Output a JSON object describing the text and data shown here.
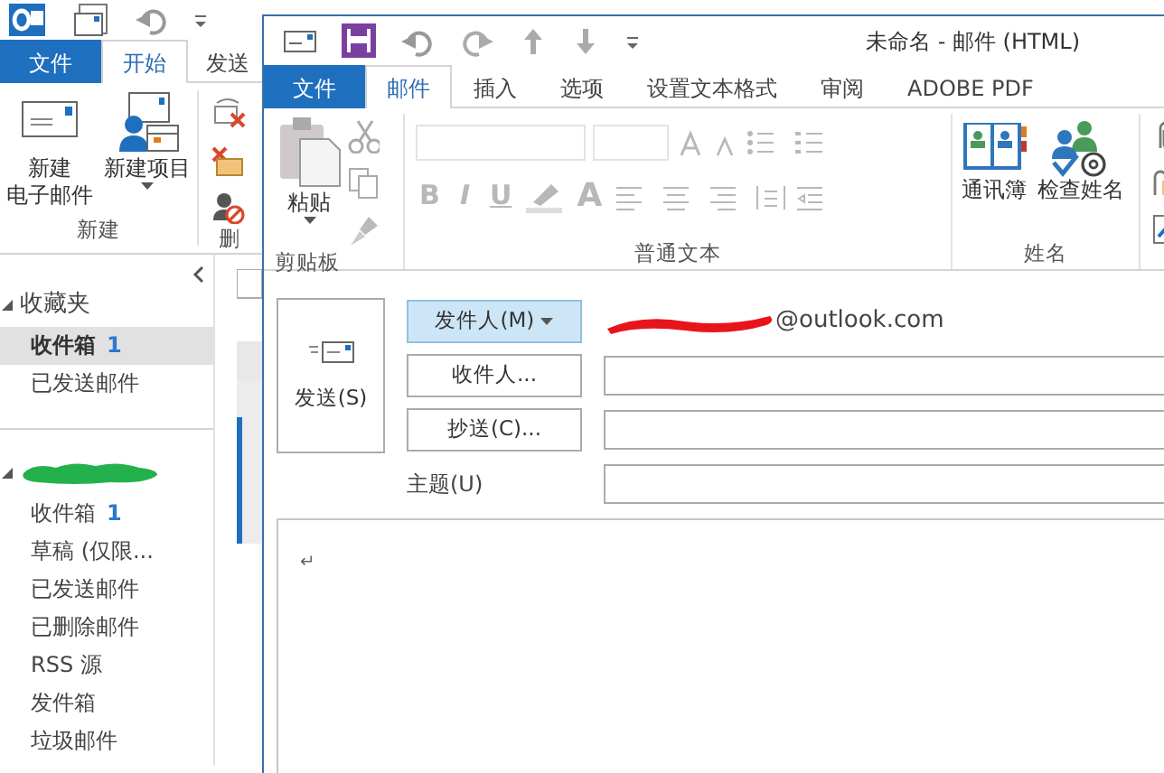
{
  "main_window": {
    "tabs": [
      {
        "label": "文件",
        "kind": "file",
        "selected": false
      },
      {
        "label": "开始",
        "kind": "tab",
        "selected": true
      },
      {
        "label": "发送",
        "kind": "tab",
        "selected": false
      }
    ],
    "ribbon_groups": [
      {
        "label": "新建",
        "buttons": [
          {
            "lines": [
              "新建",
              "电子邮件"
            ],
            "dropdown": false
          },
          {
            "lines": [
              "新建项目"
            ],
            "dropdown": true
          }
        ]
      },
      {
        "label": "删"
      }
    ],
    "folder_pane": [
      {
        "label": "收藏夹",
        "expanded": true,
        "children": [
          {
            "label": "收件箱",
            "count": "1",
            "selected": true
          },
          {
            "label": "已发送邮件",
            "selected": false
          }
        ]
      },
      {
        "redacted": true,
        "expanded": true,
        "children": [
          {
            "label": "收件箱",
            "count": "1",
            "selected": false
          },
          {
            "label": "草稿 (仅限...",
            "selected": false
          },
          {
            "label": "已发送邮件",
            "selected": false
          },
          {
            "label": "已删除邮件",
            "selected": false
          },
          {
            "label": "RSS 源",
            "selected": false
          },
          {
            "label": "发件箱",
            "selected": false
          },
          {
            "label": "垃圾邮件",
            "selected": false
          }
        ]
      }
    ]
  },
  "compose_window": {
    "title": "未命名 - 邮件 (HTML)",
    "tabs": [
      {
        "label": "文件",
        "kind": "file",
        "selected": false
      },
      {
        "label": "邮件",
        "kind": "tab",
        "selected": true
      },
      {
        "label": "插入",
        "kind": "tab",
        "selected": false
      },
      {
        "label": "选项",
        "kind": "tab",
        "selected": false
      },
      {
        "label": "设置文本格式",
        "kind": "tab",
        "selected": false
      },
      {
        "label": "审阅",
        "kind": "tab",
        "selected": false
      },
      {
        "label": "ADOBE PDF",
        "kind": "tab",
        "selected": false
      }
    ],
    "clipboard": {
      "label": "剪贴板",
      "paste": "粘贴"
    },
    "basic_text": {
      "label": "普通文本",
      "disabled": true,
      "format_buttons": [
        "B",
        "I",
        "U"
      ],
      "font_color": "A"
    },
    "names": {
      "label": "姓名",
      "buttons": [
        "通讯簿",
        "检查姓名"
      ]
    },
    "send_button": "发送(S)",
    "fields": [
      {
        "kind": "from",
        "label": "发件人(M)",
        "value": "@outlook.com",
        "redacted": true
      },
      {
        "kind": "recipient",
        "label": "收件人..."
      },
      {
        "kind": "recipient",
        "label": "抄送(C)..."
      },
      {
        "kind": "subject",
        "label": "主题(U)"
      }
    ],
    "body": {
      "paragraph_mark": "↵"
    }
  }
}
